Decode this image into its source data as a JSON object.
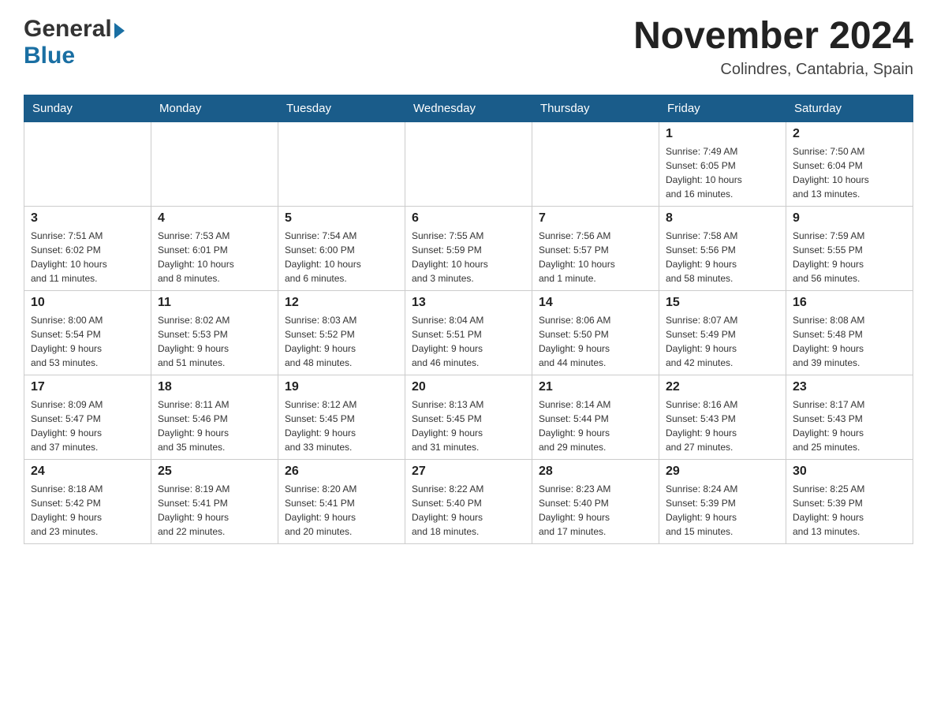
{
  "header": {
    "logo_general": "General",
    "logo_blue": "Blue",
    "month_year": "November 2024",
    "location": "Colindres, Cantabria, Spain"
  },
  "weekdays": [
    "Sunday",
    "Monday",
    "Tuesday",
    "Wednesday",
    "Thursday",
    "Friday",
    "Saturday"
  ],
  "weeks": [
    [
      {
        "day": "",
        "info": ""
      },
      {
        "day": "",
        "info": ""
      },
      {
        "day": "",
        "info": ""
      },
      {
        "day": "",
        "info": ""
      },
      {
        "day": "",
        "info": ""
      },
      {
        "day": "1",
        "info": "Sunrise: 7:49 AM\nSunset: 6:05 PM\nDaylight: 10 hours\nand 16 minutes."
      },
      {
        "day": "2",
        "info": "Sunrise: 7:50 AM\nSunset: 6:04 PM\nDaylight: 10 hours\nand 13 minutes."
      }
    ],
    [
      {
        "day": "3",
        "info": "Sunrise: 7:51 AM\nSunset: 6:02 PM\nDaylight: 10 hours\nand 11 minutes."
      },
      {
        "day": "4",
        "info": "Sunrise: 7:53 AM\nSunset: 6:01 PM\nDaylight: 10 hours\nand 8 minutes."
      },
      {
        "day": "5",
        "info": "Sunrise: 7:54 AM\nSunset: 6:00 PM\nDaylight: 10 hours\nand 6 minutes."
      },
      {
        "day": "6",
        "info": "Sunrise: 7:55 AM\nSunset: 5:59 PM\nDaylight: 10 hours\nand 3 minutes."
      },
      {
        "day": "7",
        "info": "Sunrise: 7:56 AM\nSunset: 5:57 PM\nDaylight: 10 hours\nand 1 minute."
      },
      {
        "day": "8",
        "info": "Sunrise: 7:58 AM\nSunset: 5:56 PM\nDaylight: 9 hours\nand 58 minutes."
      },
      {
        "day": "9",
        "info": "Sunrise: 7:59 AM\nSunset: 5:55 PM\nDaylight: 9 hours\nand 56 minutes."
      }
    ],
    [
      {
        "day": "10",
        "info": "Sunrise: 8:00 AM\nSunset: 5:54 PM\nDaylight: 9 hours\nand 53 minutes."
      },
      {
        "day": "11",
        "info": "Sunrise: 8:02 AM\nSunset: 5:53 PM\nDaylight: 9 hours\nand 51 minutes."
      },
      {
        "day": "12",
        "info": "Sunrise: 8:03 AM\nSunset: 5:52 PM\nDaylight: 9 hours\nand 48 minutes."
      },
      {
        "day": "13",
        "info": "Sunrise: 8:04 AM\nSunset: 5:51 PM\nDaylight: 9 hours\nand 46 minutes."
      },
      {
        "day": "14",
        "info": "Sunrise: 8:06 AM\nSunset: 5:50 PM\nDaylight: 9 hours\nand 44 minutes."
      },
      {
        "day": "15",
        "info": "Sunrise: 8:07 AM\nSunset: 5:49 PM\nDaylight: 9 hours\nand 42 minutes."
      },
      {
        "day": "16",
        "info": "Sunrise: 8:08 AM\nSunset: 5:48 PM\nDaylight: 9 hours\nand 39 minutes."
      }
    ],
    [
      {
        "day": "17",
        "info": "Sunrise: 8:09 AM\nSunset: 5:47 PM\nDaylight: 9 hours\nand 37 minutes."
      },
      {
        "day": "18",
        "info": "Sunrise: 8:11 AM\nSunset: 5:46 PM\nDaylight: 9 hours\nand 35 minutes."
      },
      {
        "day": "19",
        "info": "Sunrise: 8:12 AM\nSunset: 5:45 PM\nDaylight: 9 hours\nand 33 minutes."
      },
      {
        "day": "20",
        "info": "Sunrise: 8:13 AM\nSunset: 5:45 PM\nDaylight: 9 hours\nand 31 minutes."
      },
      {
        "day": "21",
        "info": "Sunrise: 8:14 AM\nSunset: 5:44 PM\nDaylight: 9 hours\nand 29 minutes."
      },
      {
        "day": "22",
        "info": "Sunrise: 8:16 AM\nSunset: 5:43 PM\nDaylight: 9 hours\nand 27 minutes."
      },
      {
        "day": "23",
        "info": "Sunrise: 8:17 AM\nSunset: 5:43 PM\nDaylight: 9 hours\nand 25 minutes."
      }
    ],
    [
      {
        "day": "24",
        "info": "Sunrise: 8:18 AM\nSunset: 5:42 PM\nDaylight: 9 hours\nand 23 minutes."
      },
      {
        "day": "25",
        "info": "Sunrise: 8:19 AM\nSunset: 5:41 PM\nDaylight: 9 hours\nand 22 minutes."
      },
      {
        "day": "26",
        "info": "Sunrise: 8:20 AM\nSunset: 5:41 PM\nDaylight: 9 hours\nand 20 minutes."
      },
      {
        "day": "27",
        "info": "Sunrise: 8:22 AM\nSunset: 5:40 PM\nDaylight: 9 hours\nand 18 minutes."
      },
      {
        "day": "28",
        "info": "Sunrise: 8:23 AM\nSunset: 5:40 PM\nDaylight: 9 hours\nand 17 minutes."
      },
      {
        "day": "29",
        "info": "Sunrise: 8:24 AM\nSunset: 5:39 PM\nDaylight: 9 hours\nand 15 minutes."
      },
      {
        "day": "30",
        "info": "Sunrise: 8:25 AM\nSunset: 5:39 PM\nDaylight: 9 hours\nand 13 minutes."
      }
    ]
  ]
}
